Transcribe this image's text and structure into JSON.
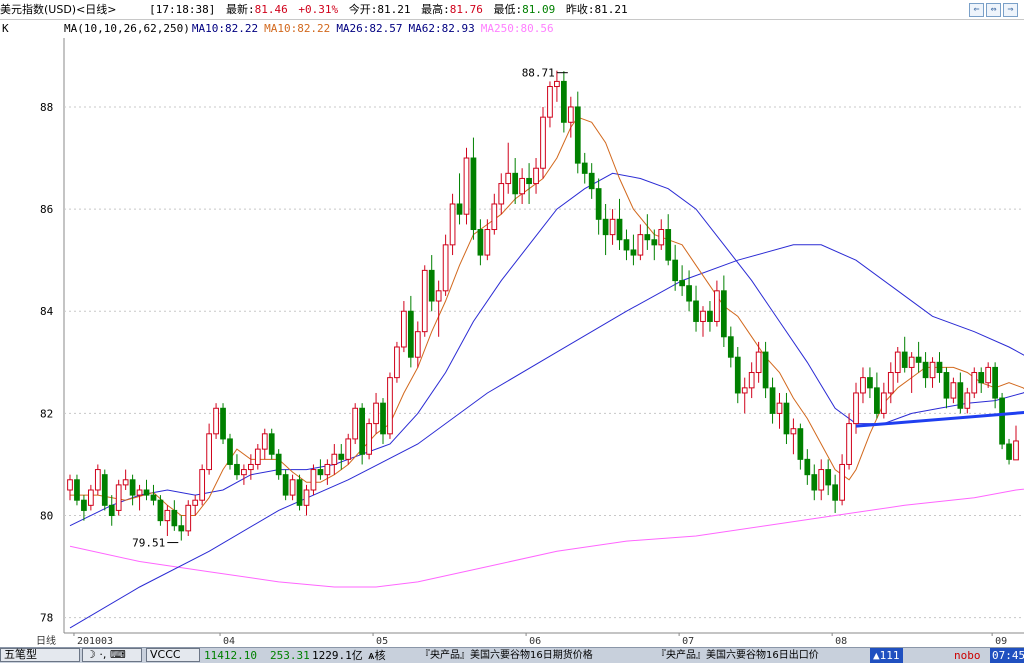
{
  "header": {
    "name": "美元指数(USD)<日线>",
    "time": "[17:18:38]",
    "latest_label": "最新:",
    "latest_value": "81.46",
    "change": "+0.31%",
    "open_label": "今开:",
    "open_value": "81.21",
    "high_label": "最高:",
    "high_value": "81.76",
    "low_label": "最低:",
    "low_value": "81.09",
    "prev_label": "昨收:",
    "prev_value": "81.21"
  },
  "controls": [
    "⇐",
    "⇔",
    "⇒"
  ],
  "indicator": {
    "k_label": "K",
    "ma_params": "MA(10,10,26,62,250)",
    "ma_values": [
      {
        "text": "MA10:82.22",
        "color": "#000080"
      },
      {
        "text": "MA10:82.22",
        "color": "#d2691e"
      },
      {
        "text": "MA26:82.57",
        "color": "#000080"
      },
      {
        "text": "MA62:82.93",
        "color": "#000080"
      },
      {
        "text": "MA250:80.56",
        "color": "#ff80ff"
      }
    ]
  },
  "colors": {
    "up": "#d0021b",
    "down": "#008000",
    "ma10": "#d2691e",
    "ma26": "#2b2bd4",
    "ma62": "#2b2bd4",
    "ma250": "#ff66ff",
    "arrow": "#1f3ff0",
    "grid": "#c8c8c8"
  },
  "chart_data": {
    "type": "candlestick",
    "ylim": [
      77.7,
      89.35
    ],
    "y_ticks": [
      78,
      80,
      82,
      84,
      86,
      88
    ],
    "x_labels": [
      {
        "label": "日线",
        "index": 0
      },
      {
        "label": "201003",
        "index": 1
      },
      {
        "label": "04",
        "index": 22
      },
      {
        "label": "05",
        "index": 44
      },
      {
        "label": "06",
        "index": 66
      },
      {
        "label": "07",
        "index": 88
      },
      {
        "label": "08",
        "index": 110
      },
      {
        "label": "09",
        "index": 133
      }
    ],
    "annotations": [
      {
        "text": "88.71",
        "index": 72,
        "value": 88.71,
        "side": "left"
      },
      {
        "text": "79.51",
        "index": 16,
        "value": 79.51,
        "side": "left"
      }
    ],
    "ohlc": [
      [
        80.5,
        80.8,
        80.3,
        80.7
      ],
      [
        80.7,
        80.8,
        80.2,
        80.3
      ],
      [
        80.3,
        80.4,
        79.9,
        80.1
      ],
      [
        80.2,
        80.6,
        80.1,
        80.5
      ],
      [
        80.5,
        81.0,
        80.4,
        80.9
      ],
      [
        80.8,
        80.9,
        80.1,
        80.2
      ],
      [
        80.2,
        80.4,
        79.8,
        80.0
      ],
      [
        80.1,
        80.7,
        80.0,
        80.6
      ],
      [
        80.6,
        80.9,
        80.5,
        80.7
      ],
      [
        80.7,
        80.8,
        80.2,
        80.4
      ],
      [
        80.4,
        80.6,
        80.1,
        80.5
      ],
      [
        80.5,
        80.7,
        80.3,
        80.4
      ],
      [
        80.4,
        80.6,
        80.2,
        80.3
      ],
      [
        80.3,
        80.4,
        79.8,
        79.9
      ],
      [
        79.9,
        80.2,
        79.6,
        80.1
      ],
      [
        80.1,
        80.3,
        79.7,
        79.8
      ],
      [
        79.8,
        80.0,
        79.51,
        79.7
      ],
      [
        79.7,
        80.3,
        79.6,
        80.2
      ],
      [
        80.2,
        80.4,
        80.0,
        80.3
      ],
      [
        80.3,
        81.0,
        80.2,
        80.9
      ],
      [
        80.9,
        81.8,
        80.8,
        81.6
      ],
      [
        81.6,
        82.2,
        81.5,
        82.1
      ],
      [
        82.1,
        82.2,
        81.4,
        81.5
      ],
      [
        81.5,
        81.6,
        80.9,
        81.0
      ],
      [
        81.0,
        81.2,
        80.7,
        80.8
      ],
      [
        80.8,
        81.0,
        80.6,
        80.9
      ],
      [
        80.9,
        81.2,
        80.7,
        81.0
      ],
      [
        81.0,
        81.4,
        80.9,
        81.3
      ],
      [
        81.3,
        81.7,
        81.1,
        81.6
      ],
      [
        81.6,
        81.7,
        81.1,
        81.2
      ],
      [
        81.2,
        81.3,
        80.7,
        80.8
      ],
      [
        80.8,
        80.9,
        80.3,
        80.4
      ],
      [
        80.4,
        80.8,
        80.3,
        80.7
      ],
      [
        80.7,
        80.8,
        80.1,
        80.2
      ],
      [
        80.2,
        80.6,
        80.0,
        80.5
      ],
      [
        80.5,
        81.0,
        80.4,
        80.9
      ],
      [
        80.9,
        81.1,
        80.7,
        80.8
      ],
      [
        80.8,
        81.1,
        80.6,
        81.0
      ],
      [
        81.0,
        81.4,
        80.8,
        81.2
      ],
      [
        81.2,
        81.4,
        80.9,
        81.1
      ],
      [
        81.1,
        81.6,
        81.0,
        81.5
      ],
      [
        81.5,
        82.2,
        81.4,
        82.1
      ],
      [
        82.1,
        82.2,
        81.0,
        81.2
      ],
      [
        81.2,
        81.9,
        81.1,
        81.8
      ],
      [
        81.8,
        82.4,
        81.6,
        82.2
      ],
      [
        82.2,
        82.3,
        81.4,
        81.6
      ],
      [
        81.6,
        82.8,
        81.5,
        82.7
      ],
      [
        82.7,
        83.4,
        82.6,
        83.3
      ],
      [
        83.3,
        84.2,
        83.2,
        84.0
      ],
      [
        84.0,
        84.3,
        82.9,
        83.1
      ],
      [
        83.1,
        83.8,
        82.9,
        83.6
      ],
      [
        83.6,
        84.9,
        83.5,
        84.8
      ],
      [
        84.8,
        85.1,
        84.0,
        84.2
      ],
      [
        84.2,
        84.6,
        83.5,
        84.4
      ],
      [
        84.4,
        85.5,
        84.3,
        85.3
      ],
      [
        85.3,
        86.3,
        85.1,
        86.1
      ],
      [
        86.1,
        86.7,
        85.7,
        85.9
      ],
      [
        85.9,
        87.2,
        85.7,
        87.0
      ],
      [
        87.0,
        87.4,
        85.4,
        85.6
      ],
      [
        85.6,
        85.8,
        84.9,
        85.1
      ],
      [
        85.1,
        85.8,
        85.0,
        85.6
      ],
      [
        85.6,
        86.3,
        85.5,
        86.1
      ],
      [
        86.1,
        86.7,
        85.9,
        86.5
      ],
      [
        86.5,
        87.3,
        86.3,
        86.7
      ],
      [
        86.7,
        87.0,
        86.1,
        86.3
      ],
      [
        86.3,
        86.8,
        86.1,
        86.6
      ],
      [
        86.6,
        86.9,
        86.1,
        86.5
      ],
      [
        86.5,
        87.0,
        86.3,
        86.8
      ],
      [
        86.8,
        88.0,
        86.6,
        87.8
      ],
      [
        87.8,
        88.5,
        87.6,
        88.4
      ],
      [
        88.4,
        88.71,
        88.1,
        88.5
      ],
      [
        88.5,
        88.7,
        87.5,
        87.7
      ],
      [
        87.7,
        88.2,
        87.4,
        88.0
      ],
      [
        88.0,
        88.3,
        86.7,
        86.9
      ],
      [
        86.9,
        87.1,
        86.5,
        86.7
      ],
      [
        86.7,
        86.9,
        86.2,
        86.4
      ],
      [
        86.4,
        86.6,
        85.5,
        85.8
      ],
      [
        85.8,
        86.1,
        85.1,
        85.5
      ],
      [
        85.5,
        86.0,
        85.3,
        85.8
      ],
      [
        85.8,
        86.2,
        85.2,
        85.4
      ],
      [
        85.4,
        85.6,
        85.0,
        85.2
      ],
      [
        85.2,
        85.5,
        84.9,
        85.1
      ],
      [
        85.1,
        85.7,
        85.0,
        85.5
      ],
      [
        85.5,
        85.9,
        85.2,
        85.4
      ],
      [
        85.4,
        85.6,
        85.0,
        85.3
      ],
      [
        85.3,
        85.8,
        85.2,
        85.6
      ],
      [
        85.6,
        85.9,
        84.9,
        85.0
      ],
      [
        85.0,
        85.3,
        84.4,
        84.6
      ],
      [
        84.6,
        84.9,
        84.3,
        84.5
      ],
      [
        84.5,
        84.8,
        84.0,
        84.2
      ],
      [
        84.2,
        84.5,
        83.6,
        83.8
      ],
      [
        83.8,
        84.1,
        83.5,
        84.0
      ],
      [
        84.0,
        84.2,
        83.6,
        83.8
      ],
      [
        83.8,
        84.6,
        83.7,
        84.4
      ],
      [
        84.4,
        84.7,
        83.3,
        83.5
      ],
      [
        83.5,
        83.7,
        82.9,
        83.1
      ],
      [
        83.1,
        83.3,
        82.2,
        82.4
      ],
      [
        82.4,
        82.7,
        82.0,
        82.5
      ],
      [
        82.5,
        83.0,
        82.3,
        82.8
      ],
      [
        82.8,
        83.4,
        82.6,
        83.2
      ],
      [
        83.2,
        83.4,
        82.3,
        82.5
      ],
      [
        82.5,
        82.7,
        81.8,
        82.0
      ],
      [
        82.0,
        82.4,
        81.7,
        82.2
      ],
      [
        82.2,
        82.4,
        81.4,
        81.6
      ],
      [
        81.6,
        81.9,
        81.2,
        81.7
      ],
      [
        81.7,
        81.8,
        80.9,
        81.1
      ],
      [
        81.1,
        81.3,
        80.6,
        80.8
      ],
      [
        80.8,
        81.0,
        80.3,
        80.5
      ],
      [
        80.5,
        81.1,
        80.3,
        80.9
      ],
      [
        80.9,
        81.1,
        80.4,
        80.6
      ],
      [
        80.6,
        80.8,
        80.05,
        80.3
      ],
      [
        80.3,
        81.2,
        80.2,
        81.0
      ],
      [
        81.0,
        82.0,
        80.9,
        81.8
      ],
      [
        81.8,
        82.6,
        81.6,
        82.4
      ],
      [
        82.4,
        82.9,
        82.2,
        82.7
      ],
      [
        82.7,
        82.9,
        82.3,
        82.5
      ],
      [
        82.5,
        82.8,
        81.9,
        82.0
      ],
      [
        82.0,
        82.6,
        81.9,
        82.4
      ],
      [
        82.4,
        83.0,
        82.2,
        82.8
      ],
      [
        82.8,
        83.3,
        82.6,
        83.2
      ],
      [
        83.2,
        83.5,
        82.8,
        82.9
      ],
      [
        82.9,
        83.2,
        82.4,
        83.1
      ],
      [
        83.1,
        83.4,
        82.8,
        83.0
      ],
      [
        83.0,
        83.2,
        82.5,
        82.7
      ],
      [
        82.7,
        83.1,
        82.5,
        83.0
      ],
      [
        83.0,
        83.2,
        82.6,
        82.8
      ],
      [
        82.8,
        82.9,
        82.1,
        82.3
      ],
      [
        82.3,
        82.7,
        82.2,
        82.6
      ],
      [
        82.6,
        82.8,
        82.0,
        82.1
      ],
      [
        82.1,
        82.5,
        82.0,
        82.4
      ],
      [
        82.4,
        82.9,
        82.3,
        82.8
      ],
      [
        82.8,
        82.9,
        82.4,
        82.6
      ],
      [
        82.6,
        83.0,
        82.5,
        82.9
      ],
      [
        82.9,
        83.0,
        82.1,
        82.3
      ],
      [
        82.3,
        82.4,
        81.3,
        81.4
      ],
      [
        81.4,
        81.5,
        81.0,
        81.1
      ],
      [
        81.09,
        81.76,
        81.09,
        81.46
      ]
    ],
    "ma10": [
      [
        0,
        80.4
      ],
      [
        4,
        80.4
      ],
      [
        8,
        80.3
      ],
      [
        12,
        80.45
      ],
      [
        14,
        80.2
      ],
      [
        16,
        80.0
      ],
      [
        18,
        80.0
      ],
      [
        20,
        80.35
      ],
      [
        22,
        80.9
      ],
      [
        24,
        81.3
      ],
      [
        26,
        81.1
      ],
      [
        28,
        81.1
      ],
      [
        30,
        81.1
      ],
      [
        32,
        80.85
      ],
      [
        34,
        80.65
      ],
      [
        36,
        80.65
      ],
      [
        38,
        80.8
      ],
      [
        40,
        81.0
      ],
      [
        42,
        81.3
      ],
      [
        44,
        81.6
      ],
      [
        46,
        81.8
      ],
      [
        48,
        82.4
      ],
      [
        50,
        82.9
      ],
      [
        52,
        83.6
      ],
      [
        54,
        84.2
      ],
      [
        56,
        84.9
      ],
      [
        58,
        85.5
      ],
      [
        60,
        85.7
      ],
      [
        62,
        85.9
      ],
      [
        64,
        86.2
      ],
      [
        66,
        86.4
      ],
      [
        68,
        86.6
      ],
      [
        70,
        87.0
      ],
      [
        72,
        87.6
      ],
      [
        73,
        87.8
      ],
      [
        75,
        87.7
      ],
      [
        77,
        87.3
      ],
      [
        79,
        86.6
      ],
      [
        81,
        86.0
      ],
      [
        84,
        85.5
      ],
      [
        86,
        85.4
      ],
      [
        88,
        85.3
      ],
      [
        90,
        84.9
      ],
      [
        92,
        84.5
      ],
      [
        94,
        84.1
      ],
      [
        96,
        83.9
      ],
      [
        98,
        83.5
      ],
      [
        100,
        83.1
      ],
      [
        102,
        82.8
      ],
      [
        104,
        82.3
      ],
      [
        106,
        81.9
      ],
      [
        108,
        81.4
      ],
      [
        110,
        80.9
      ],
      [
        112,
        80.7
      ],
      [
        113,
        80.9
      ],
      [
        115,
        81.6
      ],
      [
        117,
        82.2
      ],
      [
        119,
        82.5
      ],
      [
        121,
        82.7
      ],
      [
        123,
        82.9
      ],
      [
        125,
        82.9
      ],
      [
        127,
        82.9
      ],
      [
        129,
        82.8
      ],
      [
        131,
        82.6
      ],
      [
        133,
        82.5
      ],
      [
        135,
        82.6
      ],
      [
        137,
        82.5
      ],
      [
        139,
        82.3
      ],
      [
        140,
        82.22
      ]
    ],
    "ma26": [
      [
        0,
        79.8
      ],
      [
        6,
        80.2
      ],
      [
        10,
        80.4
      ],
      [
        14,
        80.5
      ],
      [
        18,
        80.4
      ],
      [
        22,
        80.5
      ],
      [
        26,
        80.8
      ],
      [
        30,
        80.9
      ],
      [
        34,
        80.9
      ],
      [
        38,
        81.0
      ],
      [
        42,
        81.2
      ],
      [
        46,
        81.4
      ],
      [
        50,
        82.0
      ],
      [
        54,
        82.8
      ],
      [
        58,
        83.8
      ],
      [
        62,
        84.6
      ],
      [
        66,
        85.3
      ],
      [
        70,
        86.0
      ],
      [
        74,
        86.4
      ],
      [
        78,
        86.7
      ],
      [
        82,
        86.6
      ],
      [
        86,
        86.4
      ],
      [
        90,
        86.0
      ],
      [
        94,
        85.3
      ],
      [
        98,
        84.6
      ],
      [
        102,
        83.8
      ],
      [
        106,
        83.0
      ],
      [
        110,
        82.1
      ],
      [
        113,
        81.8
      ],
      [
        117,
        81.8
      ],
      [
        121,
        82.0
      ],
      [
        125,
        82.1
      ],
      [
        129,
        82.2
      ],
      [
        133,
        82.25
      ],
      [
        137,
        82.4
      ],
      [
        140,
        82.57
      ]
    ],
    "ma62": [
      [
        0,
        77.8
      ],
      [
        10,
        78.6
      ],
      [
        20,
        79.3
      ],
      [
        30,
        80.1
      ],
      [
        40,
        80.7
      ],
      [
        50,
        81.4
      ],
      [
        60,
        82.4
      ],
      [
        70,
        83.2
      ],
      [
        80,
        84.0
      ],
      [
        88,
        84.6
      ],
      [
        96,
        85.0
      ],
      [
        104,
        85.3
      ],
      [
        108,
        85.3
      ],
      [
        113,
        85.0
      ],
      [
        118,
        84.5
      ],
      [
        124,
        83.9
      ],
      [
        130,
        83.6
      ],
      [
        135,
        83.3
      ],
      [
        140,
        82.93
      ]
    ],
    "ma250": [
      [
        0,
        79.4
      ],
      [
        10,
        79.1
      ],
      [
        20,
        78.9
      ],
      [
        30,
        78.7
      ],
      [
        38,
        78.6
      ],
      [
        44,
        78.6
      ],
      [
        50,
        78.7
      ],
      [
        60,
        79.0
      ],
      [
        70,
        79.3
      ],
      [
        80,
        79.5
      ],
      [
        90,
        79.6
      ],
      [
        100,
        79.8
      ],
      [
        110,
        80.0
      ],
      [
        120,
        80.2
      ],
      [
        130,
        80.35
      ],
      [
        136,
        80.5
      ],
      [
        140,
        80.56
      ]
    ],
    "trend_arrow": {
      "from": [
        113,
        81.75
      ],
      "to": [
        141,
        82.05
      ]
    }
  },
  "taskbar": {
    "app_name": "五笔型",
    "tabs": [
      "VCCC"
    ],
    "index_value": "11412.10",
    "index_change": "253.31",
    "volume": "1229.1亿",
    "tail": "ѧ核",
    "news1": "『央产品』美国六要谷物16日期货价格",
    "news2": "『央产品』美国六要谷物16日出口价",
    "tray_value": "111",
    "tray_label": "nobo",
    "clock": "07:45"
  }
}
